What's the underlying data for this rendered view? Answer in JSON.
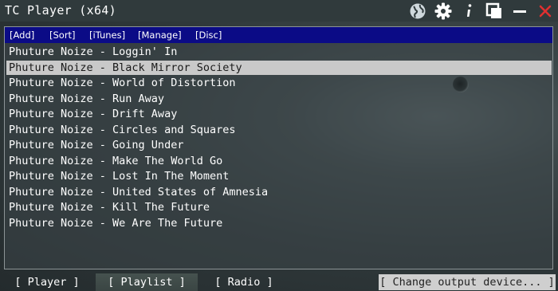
{
  "window": {
    "title": "TC Player (x64)"
  },
  "titlebar_icons": [
    {
      "name": "globe-icon"
    },
    {
      "name": "gear-icon"
    },
    {
      "name": "info-icon"
    },
    {
      "name": "restore-icon"
    },
    {
      "name": "minimize-icon"
    },
    {
      "name": "close-icon"
    }
  ],
  "menu": {
    "add": "[Add]",
    "sort": "[Sort]",
    "itunes": "[iTunes]",
    "manage": "[Manage]",
    "disc": "[Disc]"
  },
  "playlist": {
    "selected_index": 1,
    "tracks": [
      "Phuture Noize - Loggin' In",
      "Phuture Noize - Black Mirror Society",
      "Phuture Noize - World of Distortion",
      "Phuture Noize - Run Away",
      "Phuture Noize - Drift Away",
      "Phuture Noize - Circles and Squares",
      "Phuture Noize - Going Under",
      "Phuture Noize - Make The World Go",
      "Phuture Noize - Lost In The Moment",
      "Phuture Noize - United States of Amnesia",
      "Phuture Noize - Kill The Future",
      "Phuture Noize - We Are The Future"
    ]
  },
  "tabs": {
    "player": "[ Player ]",
    "playlist": "[ Playlist ]",
    "radio": "[ Radio ]",
    "active": "playlist"
  },
  "output": {
    "label": "[ Change output device... ]"
  },
  "colors": {
    "menubar": "#0b0b86",
    "selection": "#c9c9c9",
    "close": "#e03030",
    "accent_icon": "#cfd8dc"
  }
}
